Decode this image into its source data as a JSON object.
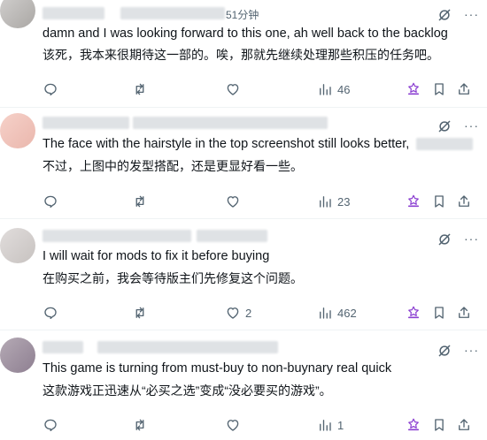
{
  "posts": [
    {
      "meta": "51分钟",
      "text_en": "damn and I was looking forward to this one, ah well back to the backlog",
      "text_zh": "该死，我本来很期待这一部的。唉，那就先继续处理那些积压的任务吧。",
      "replies": "",
      "reposts": "",
      "likes": "",
      "views": "46"
    },
    {
      "meta": "",
      "text_en": "The face with the hairstyle in the top screenshot still looks better,",
      "text_zh": "不过，上图中的发型搭配，还是更显好看一些。",
      "replies": "",
      "reposts": "",
      "likes": "",
      "views": "23"
    },
    {
      "meta": "",
      "text_en": "I will wait for mods to fix it before buying",
      "text_zh": "在购买之前，我会等待版主们先修复这个问题。",
      "replies": "",
      "reposts": "",
      "likes": "2",
      "views": "462"
    },
    {
      "meta": "",
      "text_en": "This game is  turning from must-buy to non-buynary real quick",
      "text_zh": "这款游戏正迅速从“必买之选”变成“没必要买的游戏”。",
      "replies": "",
      "reposts": "",
      "likes": "",
      "views": "1"
    }
  ],
  "icons": {
    "grok": "grok-icon",
    "more": "more-icon",
    "reply": "reply-icon",
    "repost": "repost-icon",
    "like": "like-icon",
    "views": "views-icon",
    "translate": "translate-icon",
    "bookmark": "bookmark-icon",
    "share": "share-icon"
  },
  "colors": {
    "text": "#0f1419",
    "secondary": "#536471",
    "accent": "#8b3fd1",
    "divider": "#eff3f4"
  }
}
